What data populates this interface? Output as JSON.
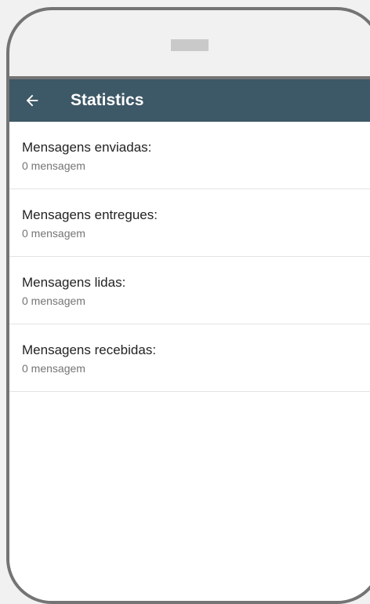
{
  "app_bar": {
    "title": "Statistics",
    "back_icon": "arrow-left-icon"
  },
  "stats": [
    {
      "label": "Mensagens enviadas:",
      "value": "0 mensagem"
    },
    {
      "label": "Mensagens entregues:",
      "value": "0 mensagem"
    },
    {
      "label": "Mensagens lidas:",
      "value": "0 mensagem"
    },
    {
      "label": "Mensagens recebidas:",
      "value": "0 mensagem"
    }
  ],
  "colors": {
    "app_bar": "#3d5866",
    "frame": "#747474",
    "background": "#f1f1f1"
  }
}
